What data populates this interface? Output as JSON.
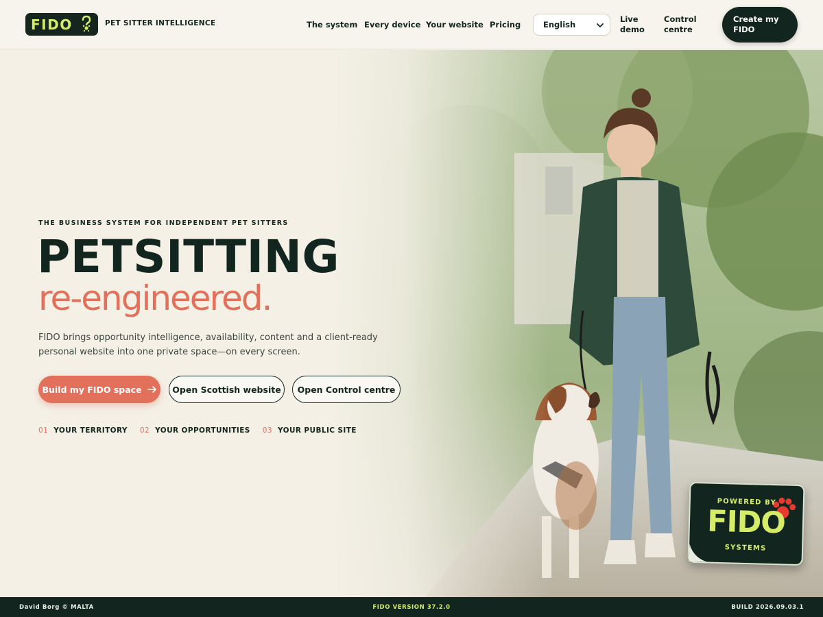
{
  "header": {
    "logo_text": "FIDO",
    "tagline": "PET SITTER INTELLIGENCE",
    "nav": [
      "The system",
      "Every device",
      "Your website",
      "Pricing"
    ],
    "language": "English",
    "live_demo": [
      "Live",
      "demo"
    ],
    "control_centre": [
      "Control",
      "centre"
    ],
    "cta": [
      "Create my",
      "FIDO"
    ]
  },
  "hero": {
    "eyebrow": "THE BUSINESS SYSTEM FOR INDEPENDENT PET SITTERS",
    "headline": "PETSITTING",
    "subhead": "re-engineered.",
    "lede": "FIDO brings opportunity intelligence, availability, content and a client-ready personal website into one private space—on every screen.",
    "buttons": {
      "primary": "Build my FIDO space",
      "scottish": "Open Scottish website",
      "control": "Open Control centre"
    },
    "steps": [
      {
        "num": "01",
        "label": "YOUR TERRITORY"
      },
      {
        "num": "02",
        "label": "YOUR OPPORTUNITIES"
      },
      {
        "num": "03",
        "label": "YOUR PUBLIC SITE"
      }
    ]
  },
  "badge": {
    "top": "POWERED BY",
    "main": "FIDO",
    "bottom": "SYSTEMS"
  },
  "footer": {
    "left": "David Borg © MALTA",
    "center": "FIDO VERSION 37.2.0",
    "right": "BUILD 2026.09.03.1"
  },
  "colors": {
    "dark": "#13251f",
    "accent": "#e2705a",
    "lime": "#d4ec67",
    "background": "#f5f1e8"
  },
  "icons": [
    "paw-question-icon",
    "chevron-down-icon",
    "arrow-right-icon",
    "paw-print-icon"
  ]
}
